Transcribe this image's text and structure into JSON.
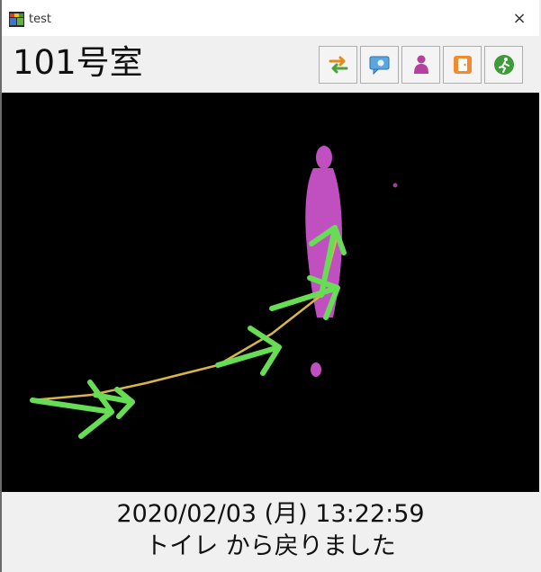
{
  "window": {
    "title": "test",
    "close_glyph": "×"
  },
  "header": {
    "room": "101号室"
  },
  "toolbar": [
    {
      "icon": "swap-arrows-icon"
    },
    {
      "icon": "chat-bubble-icon"
    },
    {
      "icon": "person-icon"
    },
    {
      "icon": "door-icon"
    },
    {
      "icon": "running-person-icon"
    }
  ],
  "camera": {
    "background": "#000000",
    "person_color": "#c050c0",
    "arrow_color": "#66dd55",
    "path_color": "#d8b44a"
  },
  "status": {
    "datetime": "2020/02/03 (月) 13:22:59",
    "message": "トイレ から戻りました"
  }
}
